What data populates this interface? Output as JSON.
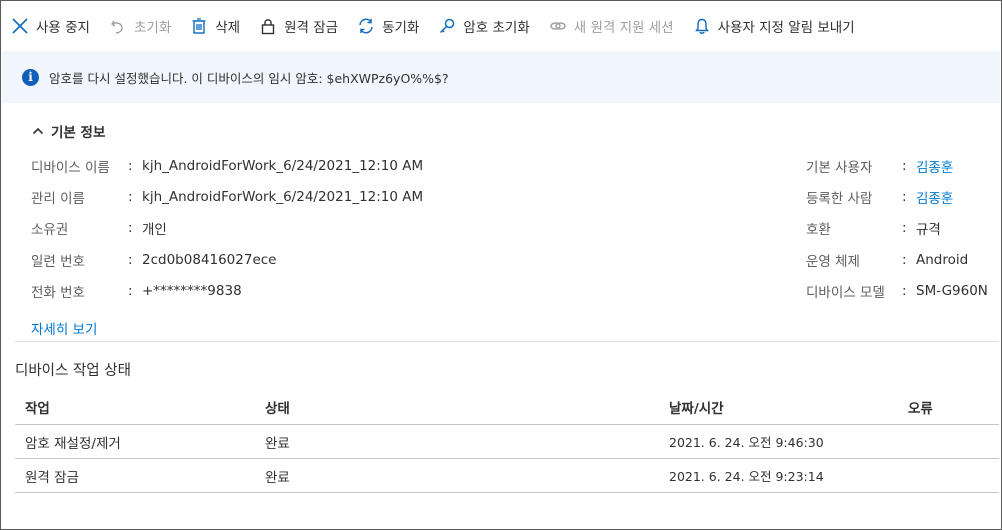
{
  "toolbar": {
    "items": [
      {
        "label": "사용 중지",
        "icon": "close-icon",
        "enabled": true
      },
      {
        "label": "초기화",
        "icon": "undo-icon",
        "enabled": false
      },
      {
        "label": "삭제",
        "icon": "trash-icon",
        "enabled": true
      },
      {
        "label": "원격 잠금",
        "icon": "lock-icon",
        "enabled": true
      },
      {
        "label": "동기화",
        "icon": "sync-icon",
        "enabled": true
      },
      {
        "label": "암호 초기화",
        "icon": "key-icon",
        "enabled": true
      },
      {
        "label": "새 원격 지원 세션",
        "icon": "link-icon",
        "enabled": false
      },
      {
        "label": "사용자 지정 알림 보내기",
        "icon": "bell-icon",
        "enabled": true
      }
    ]
  },
  "infobar": {
    "message": "암호를 다시 설정했습니다. 이 디바이스의 임시 암호: $ehXWPz6yO%%$?",
    "icon": "info-icon",
    "color": "#0f60b6"
  },
  "basic_info": {
    "title": "기본 정보",
    "separator": ":",
    "left": [
      {
        "label": "디바이스 이름",
        "value": "kjh_AndroidForWork_6/24/2021_12:10 AM"
      },
      {
        "label": "관리 이름",
        "value": "kjh_AndroidForWork_6/24/2021_12:10 AM"
      },
      {
        "label": "소유권",
        "value": "개인"
      },
      {
        "label": "일련 번호",
        "value": "2cd0b08416027ece"
      },
      {
        "label": "전화 번호",
        "value": "+********9838"
      }
    ],
    "right": [
      {
        "label": "기본 사용자",
        "value": "김종훈",
        "link": true
      },
      {
        "label": "등록한 사람",
        "value": "김종훈",
        "link": true
      },
      {
        "label": "호환",
        "value": "규격",
        "link": false
      },
      {
        "label": "운영 체제",
        "value": "Android",
        "link": false
      },
      {
        "label": "디바이스 모델",
        "value": "SM-G960N",
        "link": false
      }
    ],
    "more_link": "자세히 보기"
  },
  "device_actions": {
    "title": "디바이스 작업 상태",
    "columns": [
      "작업",
      "상태",
      "날짜/시간",
      "오류"
    ],
    "rows": [
      [
        "암호 재설정/제거",
        "완료",
        "2021. 6. 24. 오전 9:46:30",
        ""
      ],
      [
        "원격 잠금",
        "완료",
        "2021. 6. 24. 오전 9:23:14",
        ""
      ]
    ]
  },
  "colors": {
    "link": "#0078d4",
    "info_bg": "#f0f6fc",
    "disabled": "#a19f9d"
  }
}
